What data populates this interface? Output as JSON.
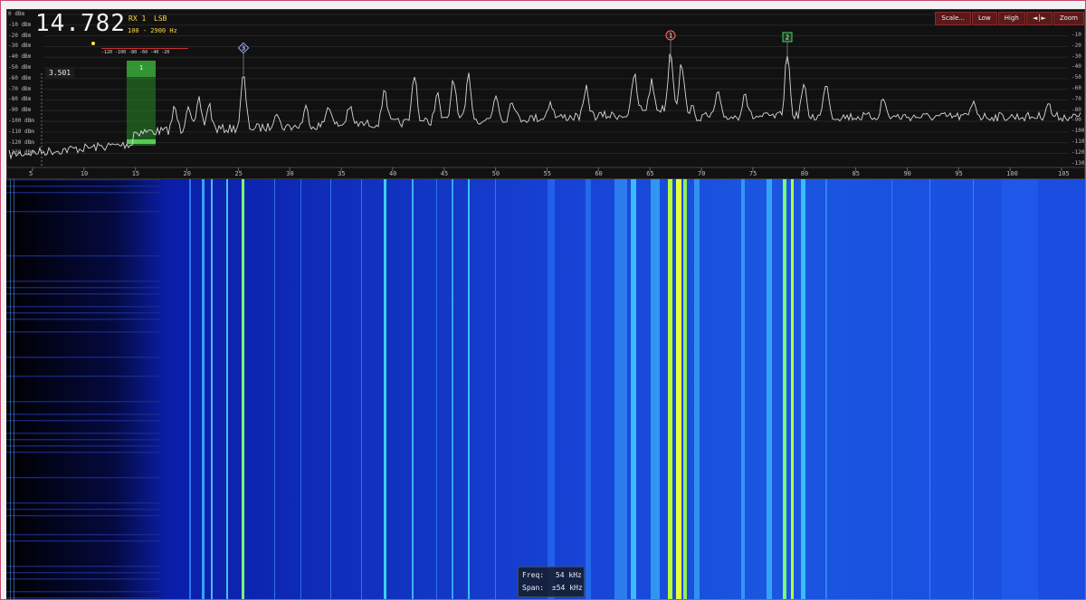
{
  "receiver": {
    "frequency": "14.782",
    "rx": "RX 1",
    "mode": "LSB",
    "bandwidth": "100 - 2900 Hz",
    "smeter_scale": "-120 -100 -80 -60 -40 -20",
    "cursor_readout": "3.501"
  },
  "toolbar": {
    "scale": "Scale...",
    "low": "Low",
    "high": "High",
    "fit": "◄│►",
    "zoom": "Zoom"
  },
  "spectrum": {
    "left_db_labels": [
      "0 dBm",
      "-10 dBm",
      "-20 dBm",
      "-30 dBm",
      "-40 dBm",
      "-50 dBm",
      "-60 dBm",
      "-70 dBm",
      "-80 dBm",
      "-90 dBm",
      "-100 dBm",
      "-110 dBm",
      "-120 dBm",
      "-130 dBm"
    ],
    "right_db_labels": [
      "-10 dB",
      "-20 dB",
      "-30 dB",
      "-40 dB",
      "-50 dB",
      "-60 dB",
      "-70 dB",
      "-80 dB",
      "-90 dB",
      "-100 dB",
      "-110 dB",
      "-120 dB",
      "-130 dB"
    ],
    "x_ticks": [
      "5",
      "10",
      "15",
      "20",
      "25",
      "30",
      "35",
      "40",
      "45",
      "50",
      "55",
      "60",
      "65",
      "70",
      "75",
      "80",
      "85",
      "90",
      "95",
      "100",
      "105"
    ],
    "markers": [
      {
        "label": "3",
        "color": "#8fa0ff",
        "shape": "diamond"
      },
      {
        "label": "1",
        "color": "#ff6a6a",
        "shape": "circle"
      },
      {
        "label": "2",
        "color": "#49d36b",
        "shape": "square"
      }
    ],
    "passband_label": "1"
  },
  "info": {
    "freq_label": "Freq:",
    "freq_value": "54 kHz",
    "span_label": "Span:",
    "span_value": "±54 kHz"
  },
  "colors": {
    "accent": "#ffd84a",
    "toolbar_bg": "#5a1a1a",
    "waterfall_bg": "#0a20b0",
    "trace": "#d8d8d8"
  }
}
